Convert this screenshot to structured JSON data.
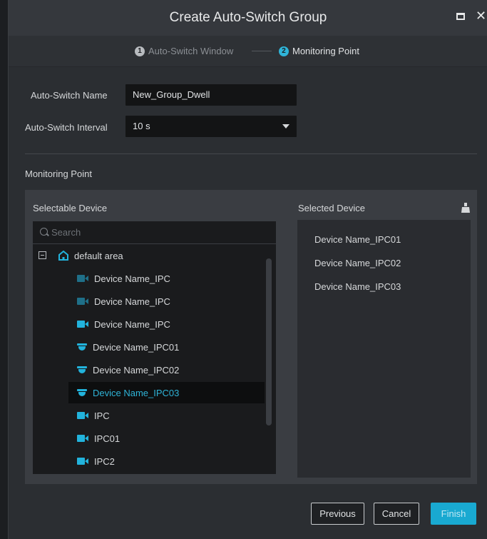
{
  "dialog": {
    "title": "Create Auto-Switch Group",
    "steps": [
      {
        "number": "1",
        "label": "Auto-Switch Window",
        "state": "done"
      },
      {
        "number": "2",
        "label": "Monitoring Point",
        "state": "active"
      }
    ]
  },
  "form": {
    "name_label": "Auto-Switch Name",
    "name_value": "New_Group_Dwell",
    "interval_label": "Auto-Switch Interval",
    "interval_value": "10 s"
  },
  "monitoring": {
    "section_title": "Monitoring Point",
    "selectable_header": "Selectable Device",
    "selected_header": "Selected Device",
    "search_placeholder": "Search",
    "tree": {
      "root_label": "default area",
      "items": [
        {
          "label": "Device Name_IPC",
          "icon": "camera-offline-icon"
        },
        {
          "label": "Device Name_IPC",
          "icon": "camera-offline-icon"
        },
        {
          "label": "Device Name_IPC",
          "icon": "camera-icon"
        },
        {
          "label": "Device Name_IPC01",
          "icon": "dome-camera-icon"
        },
        {
          "label": "Device Name_IPC02",
          "icon": "dome-camera-icon"
        },
        {
          "label": "Device Name_IPC03",
          "icon": "dome-camera-icon",
          "selected": true
        },
        {
          "label": "IPC",
          "icon": "camera-icon"
        },
        {
          "label": "IPC01",
          "icon": "camera-icon"
        },
        {
          "label": "IPC2",
          "icon": "camera-icon"
        }
      ]
    },
    "selected_devices": [
      "Device Name_IPC01",
      "Device Name_IPC02",
      "Device Name_IPC03"
    ]
  },
  "buttons": {
    "previous": "Previous",
    "cancel": "Cancel",
    "finish": "Finish"
  },
  "colors": {
    "accent": "#19a9d1",
    "offline_icon": "#1f6f88",
    "online_icon": "#22b3dc"
  }
}
